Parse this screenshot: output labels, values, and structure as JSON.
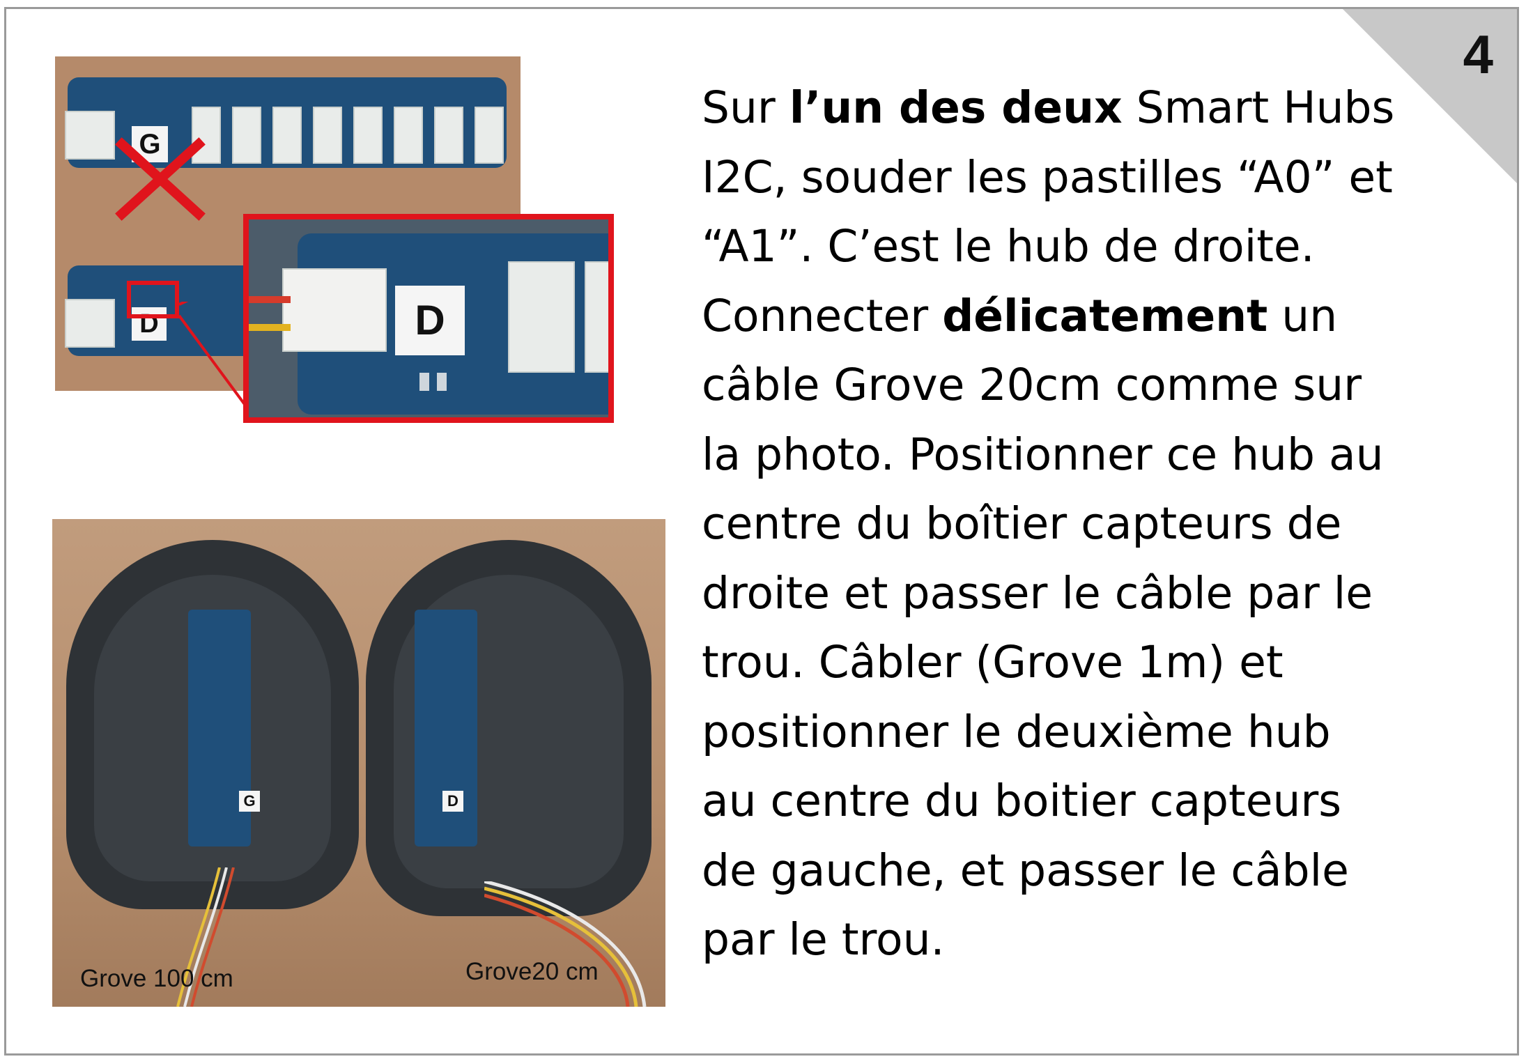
{
  "step_number": "4",
  "instruction": {
    "lines": [
      [
        {
          "t": "Sur ",
          "b": false
        },
        {
          "t": "l’un des deux",
          "b": true
        },
        {
          "t": " Smart Hubs",
          "b": false
        }
      ],
      [
        {
          "t": "I2C, souder les pastilles “A0” et",
          "b": false
        }
      ],
      [
        {
          "t": "“A1”. C’est le hub de droite.",
          "b": false
        }
      ],
      [
        {
          "t": "Connecter ",
          "b": false
        },
        {
          "t": "délicatement",
          "b": true
        },
        {
          "t": " un",
          "b": false
        }
      ],
      [
        {
          "t": "câble Grove 20cm comme sur",
          "b": false
        }
      ],
      [
        {
          "t": "la photo. Positionner ce hub au",
          "b": false
        }
      ],
      [
        {
          "t": "centre du boîtier capteurs de",
          "b": false
        }
      ],
      [
        {
          "t": "droite et passer le câble par le",
          "b": false
        }
      ],
      [
        {
          "t": "trou. Câbler (Grove 1m) et",
          "b": false
        }
      ],
      [
        {
          "t": "positionner le deuxième hub",
          "b": false
        }
      ],
      [
        {
          "t": "au centre du boitier capteurs",
          "b": false
        }
      ],
      [
        {
          "t": "de gauche, et passer le câble",
          "b": false
        }
      ],
      [
        {
          "t": "par le trou.",
          "b": false
        }
      ]
    ]
  },
  "top_photo": {
    "hub_labels": [
      "G",
      "D"
    ]
  },
  "bottom_photo": {
    "hub_labels": [
      "G",
      "D"
    ],
    "caption_left": "Grove 100 cm",
    "caption_right": "Grove20 cm"
  },
  "colors": {
    "highlight_red": "#e0141c",
    "pcb_blue": "#1f4f7a",
    "corner_gray": "#c8c8c8"
  }
}
